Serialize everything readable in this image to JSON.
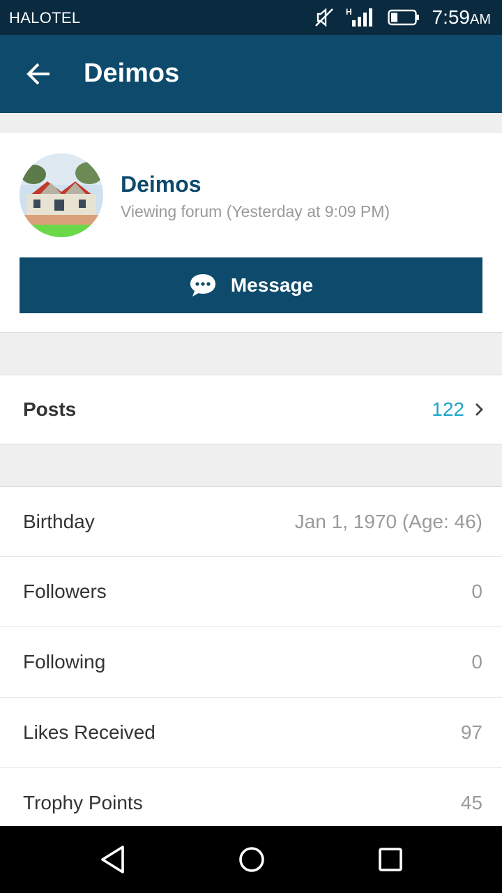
{
  "status_bar": {
    "carrier": "HALOTEL",
    "network": "H",
    "time": "7:59",
    "ampm": "AM"
  },
  "app_bar": {
    "title": "Deimos"
  },
  "profile": {
    "name": "Deimos",
    "status": "Viewing forum (Yesterday at 9:09 PM)",
    "message_label": "Message"
  },
  "posts": {
    "label": "Posts",
    "value": "122"
  },
  "stats": [
    {
      "label": "Birthday",
      "value": "Jan 1, 1970 (Age: 46)"
    },
    {
      "label": "Followers",
      "value": "0"
    },
    {
      "label": "Following",
      "value": "0"
    },
    {
      "label": "Likes Received",
      "value": "97"
    },
    {
      "label": "Trophy Points",
      "value": "45"
    }
  ],
  "colors": {
    "primary": "#0d4a6b",
    "status_bar": "#0a2a3f",
    "accent": "#1ba6cc",
    "background": "#efefef"
  }
}
